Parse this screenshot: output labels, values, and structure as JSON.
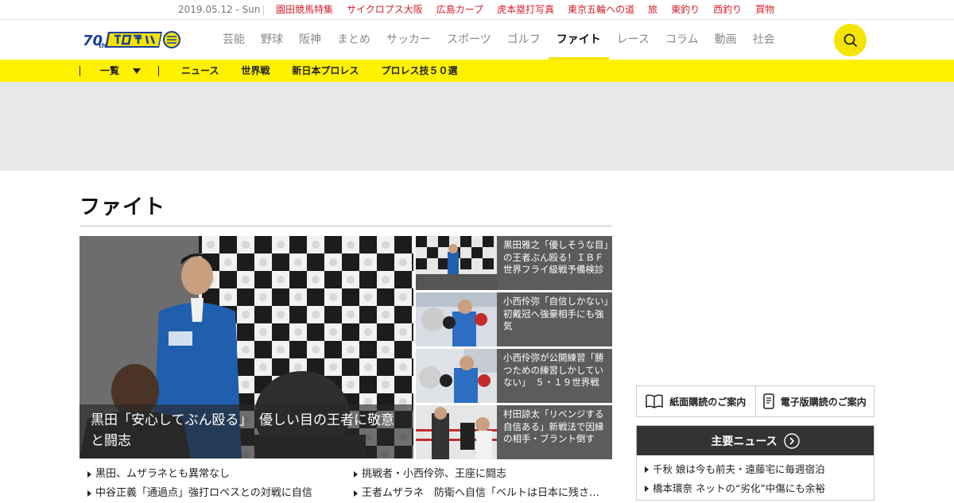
{
  "top_strip": {
    "date": "2019.05.12 - Sun",
    "links": [
      "園田競馬特集",
      "サイクロプス大阪",
      "広島カープ",
      "虎本塁打写真",
      "東京五輪への道",
      "旅",
      "東釣り",
      "西釣り",
      "買物"
    ]
  },
  "header": {
    "nav": [
      "芸能",
      "野球",
      "阪神",
      "まとめ",
      "サッカー",
      "スポーツ",
      "ゴルフ",
      "ファイト",
      "レース",
      "コラム",
      "動画",
      "社会"
    ],
    "active_nav": "ファイト"
  },
  "subnav": {
    "list_label": "一覧",
    "links": [
      "ニュース",
      "世界戦",
      "新日本プロレス",
      "プロレス技５０選"
    ]
  },
  "section": {
    "title": "ファイト"
  },
  "hero": {
    "caption": "黒田「安心してぶん殴る」　優しい目の王者に敬意と闘志"
  },
  "side_stories": [
    {
      "title": "黒田雅之「優しそうな目」の王者ぶん殴る！ＩＢＦ世界フライ級戦予備検診"
    },
    {
      "title": "小西伶弥「自信しかない」初戴冠へ強豪相手にも強気"
    },
    {
      "title": "小西伶弥が公開練習「勝つための練習しかしていない」　５・１９世界戦"
    },
    {
      "title": "村田諒太「リベンジする自信ある」新戦法で因縁の相手・ブラント倒す"
    }
  ],
  "list_left": [
    "黒田、ムザラネとも異常なし",
    "中谷正義「通過点」強打ロペスとの対戦に自信"
  ],
  "list_right": [
    "挑戦者・小西伶弥、王座に闘志",
    "王者ムザラネ　防衛へ自信「ベルトは日本に残さない」"
  ],
  "subscribe": {
    "paper": "紙面購読のご案内",
    "digital": "電子版購読のご案内"
  },
  "main_news": {
    "title": "主要ニュース",
    "items": [
      "千秋 娘は今も前夫・遠藤宅に毎週宿泊",
      "橋本環奈 ネットの“劣化”中傷にも余裕"
    ]
  },
  "colors": {
    "brand_yellow": "#fff100",
    "accent_red": "#d4202a",
    "dark": "#333333"
  }
}
